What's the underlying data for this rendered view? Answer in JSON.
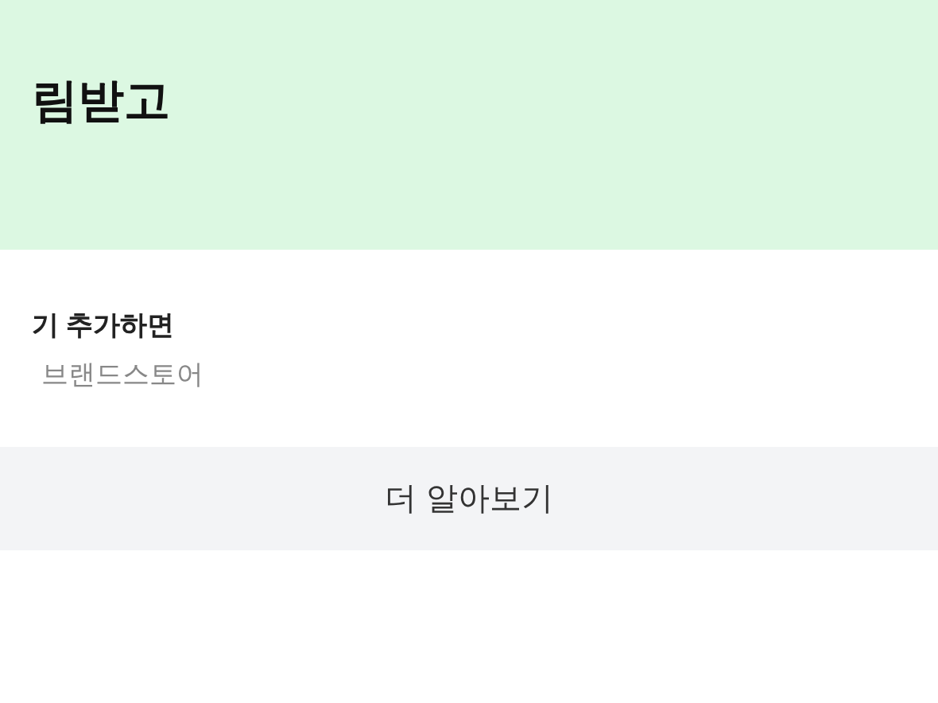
{
  "banner": {
    "title": "림받고"
  },
  "info": {
    "headline": "기 추가하면",
    "subtext": "브랜드스토어"
  },
  "button": {
    "label": "더 알아보기"
  }
}
